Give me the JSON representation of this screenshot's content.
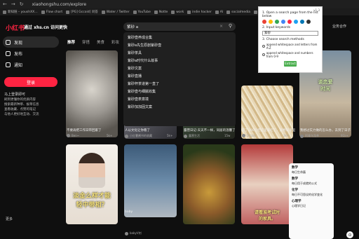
{
  "browser": {
    "url": "xiaohongshu.com/explore",
    "bookmarks": [
      "新知链 – youshXX…",
      "Flow chart",
      "[PG] Gccoid] 问答",
      "Water / Twitter",
      "YouTube",
      "Notte",
      "work",
      "indie hacker",
      "AI",
      "socialmedia",
      "tools",
      "Chrome Web"
    ]
  },
  "brand": {
    "logo": "小红书",
    "promo": "通过 xhs.cn 访问更快"
  },
  "sidebar": {
    "items": [
      {
        "label": "发现"
      },
      {
        "label": "发布"
      },
      {
        "label": "通知"
      }
    ],
    "login": "登录",
    "info_title": "马上登录即可",
    "info_lines": [
      "刷到更懂你的优质内容",
      "搜索最新种草、拔草信息",
      "查看收藏、点赞的笔记",
      "与他人更好地互动、交流"
    ],
    "more": "更多"
  },
  "search": {
    "value": "紫砂 a",
    "clear": "×",
    "mag": "⚲"
  },
  "tabs": [
    "推荐",
    "穿搭",
    "美食",
    "彩妆",
    "影视"
  ],
  "right_tab": "业务合作",
  "suggestions": [
    "紫砂壶养成合集",
    "紫砂a先生原創紫砂壶",
    "紫砂茶具",
    "紫砂a时代什么故事",
    "紫砂文案",
    "紫砂直播",
    "紫砂杯茶道第一直了",
    "紫砂壶与细腻收集",
    "紫砂壶表意境",
    "紫砂加加固文案"
  ],
  "extension": {
    "version": "v1.3",
    "step1": "1.  Open a search page from the list below",
    "step2": "2.  Input keywords",
    "keyword": "紫砂",
    "step3": "3.  Choose search methods",
    "opt1": "append whitespace and letters from A-Z",
    "opt2": "append whitespace and numbers from 0-9",
    "extract": "Extract",
    "icon_colors": [
      "#ea4335",
      "#fbbc05",
      "#34a853",
      "#4285f4",
      "#ff2442",
      "#1da1f2",
      "#0077b5",
      "#333333"
    ]
  },
  "cards": [
    {
      "caption": "不要再把工作日带回家了",
      "author": "Ben~",
      "likes": "5k+"
    },
    {
      "caption": "人以文化让你看了",
      "author": "小红薯酱书的收藏",
      "likes": "5k+"
    },
    {
      "caption": "露营日记-天天不一样，同居的温馨了",
      "author": "露营生活",
      "likes": "15w"
    },
    {
      "caption": "花了300元把这里来吃了，就想知道里",
      "author": "Drizzy",
      "likes": "1k+"
    },
    {
      "caption": "我想过实力做的怎么办，去到了日子",
      "author": "阿青乌龙茶",
      "likes": "91k+"
    },
    {
      "caption": "baby",
      "author": "babyV剂",
      "likes": ""
    }
  ],
  "overlays": [
    "谈恋爱\n时间",
    "越恋爱越有体验\n这也要感同身？",
    "说真的，你们\n做这道真是\n是分人的",
    "淡金么样才能\n轻中带相？",
    "请看准考试时\n的家具。"
  ],
  "right_panel": {
    "h1": "数学",
    "l1": "每日生命篇",
    "h2": "数学",
    "l2": "每日用于成就的公式",
    "h3": "化学",
    "l3": "每日不可思议的化学变化",
    "h4": "心理学",
    "l4": "心理学日记"
  },
  "fab": "⊙"
}
